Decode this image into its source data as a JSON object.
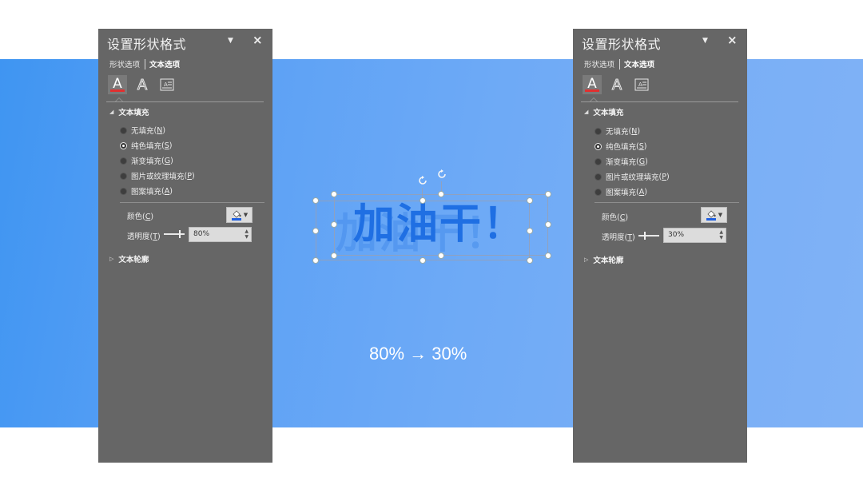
{
  "colors": {
    "panel_bg": "#666666",
    "accent_text_blue": "#1f6fe3",
    "icon_underline_red": "#e03030",
    "color_swatch_blue": "#1f5fe0"
  },
  "panels": [
    {
      "title": "设置形状格式",
      "tabs": [
        {
          "label": "形状选项",
          "active": false
        },
        {
          "label": "文本选项",
          "active": true
        }
      ],
      "icons": [
        "text-fill-outline-icon",
        "text-effects-icon",
        "textbox-icon"
      ],
      "section_fill": "文本填充",
      "radios": [
        {
          "label": "无填充",
          "key": "N",
          "checked": false
        },
        {
          "label": "纯色填充",
          "key": "S",
          "checked": true
        },
        {
          "label": "渐变填充",
          "key": "G",
          "checked": false
        },
        {
          "label": "图片或纹理填充",
          "key": "P",
          "checked": false
        },
        {
          "label": "图案填充",
          "key": "A",
          "checked": false
        }
      ],
      "color_label": "颜色",
      "color_key": "C",
      "transparency_label": "透明度",
      "transparency_key": "T",
      "transparency_value": "80%",
      "transparency_fraction": 0.8,
      "section_outline": "文本轮廓"
    },
    {
      "title": "设置形状格式",
      "tabs": [
        {
          "label": "形状选项",
          "active": false
        },
        {
          "label": "文本选项",
          "active": true
        }
      ],
      "icons": [
        "text-fill-outline-icon",
        "text-effects-icon",
        "textbox-icon"
      ],
      "section_fill": "文本填充",
      "radios": [
        {
          "label": "无填充",
          "key": "N",
          "checked": false
        },
        {
          "label": "纯色填充",
          "key": "S",
          "checked": true
        },
        {
          "label": "渐变填充",
          "key": "G",
          "checked": false
        },
        {
          "label": "图片或纹理填充",
          "key": "P",
          "checked": false
        },
        {
          "label": "图案填充",
          "key": "A",
          "checked": false
        }
      ],
      "color_label": "颜色",
      "color_key": "C",
      "transparency_label": "透明度",
      "transparency_key": "T",
      "transparency_value": "30%",
      "transparency_fraction": 0.3,
      "section_outline": "文本轮廓"
    }
  ],
  "canvas": {
    "text": "加油干！",
    "caption": "80% → 30%"
  }
}
